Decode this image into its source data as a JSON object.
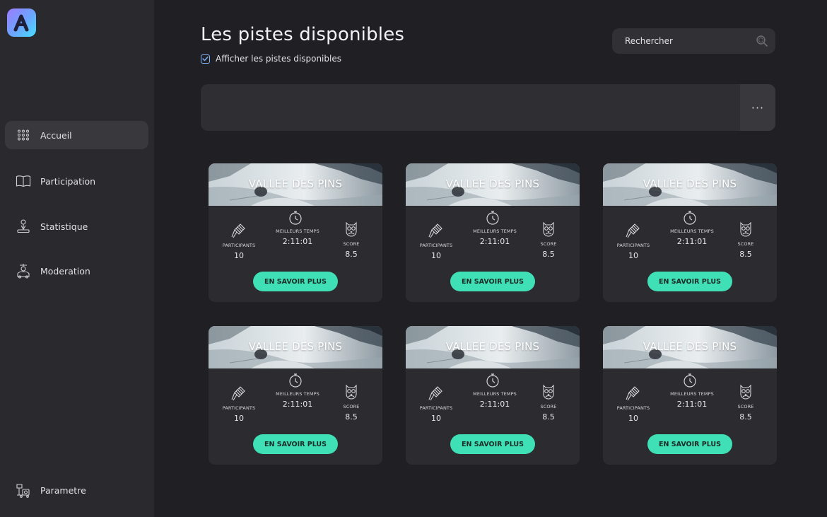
{
  "sidebar": {
    "items": [
      {
        "label": "Accueil",
        "icon": "grid-dots-icon",
        "active": true
      },
      {
        "label": "Participation",
        "icon": "open-book-icon"
      },
      {
        "label": "Statistique",
        "icon": "user-podium-icon"
      },
      {
        "label": "Moderation",
        "icon": "moderator-icon"
      }
    ],
    "footer_item": {
      "label": "Parametre",
      "icon": "settings-machine-icon"
    }
  },
  "header": {
    "title": "Les pistes disponibles",
    "checkbox_label": "Afficher les pistes disponibles",
    "checkbox_checked": true
  },
  "search": {
    "placeholder": "Rechercher",
    "value": ""
  },
  "banner": {
    "more_label": "···"
  },
  "colors": {
    "accent": "#3fe0b5",
    "background": "#202024",
    "sidebar": "#2a2a2e",
    "card": "#2b2b30"
  },
  "cards": [
    {
      "title": "VALLEE DES PINS",
      "participants_label": "PARTICIPANTS",
      "participants": "10",
      "best_time_label": "MEILLEURS TEMPS",
      "best_time": "2:11:01",
      "score_label": "SCORE",
      "score": "8.5",
      "button": "EN SAVOIR PLUS"
    },
    {
      "title": "VALLEE DES PINS",
      "participants_label": "PARTICIPANTS",
      "participants": "10",
      "best_time_label": "MEILLEURS TEMPS",
      "best_time": "2:11:01",
      "score_label": "SCORE",
      "score": "8.5",
      "button": "EN SAVOIR PLUS"
    },
    {
      "title": "VALLEE DES PINS",
      "participants_label": "PARTICIPANTS",
      "participants": "10",
      "best_time_label": "MEILLEURS TEMPS",
      "best_time": "2:11:01",
      "score_label": "SCORE",
      "score": "8.5",
      "button": "EN SAVOIR PLUS"
    },
    {
      "title": "VALLEE DES PINS",
      "participants_label": "PARTICIPANTS",
      "participants": "10",
      "best_time_label": "MEILLEURS TEMPS",
      "best_time": "2:11:01",
      "score_label": "SCORE",
      "score": "8.5",
      "button": "EN SAVOIR PLUS"
    },
    {
      "title": "VALLEE DES PINS",
      "participants_label": "PARTICIPANTS",
      "participants": "10",
      "best_time_label": "MEILLEURS TEMPS",
      "best_time": "2:11:01",
      "score_label": "SCORE",
      "score": "8.5",
      "button": "EN SAVOIR PLUS"
    },
    {
      "title": "VALLEE DES PINS",
      "participants_label": "PARTICIPANTS",
      "participants": "10",
      "best_time_label": "MEILLEURS TEMPS",
      "best_time": "2:11:01",
      "score_label": "SCORE",
      "score": "8.5",
      "button": "EN SAVOIR PLUS"
    }
  ]
}
